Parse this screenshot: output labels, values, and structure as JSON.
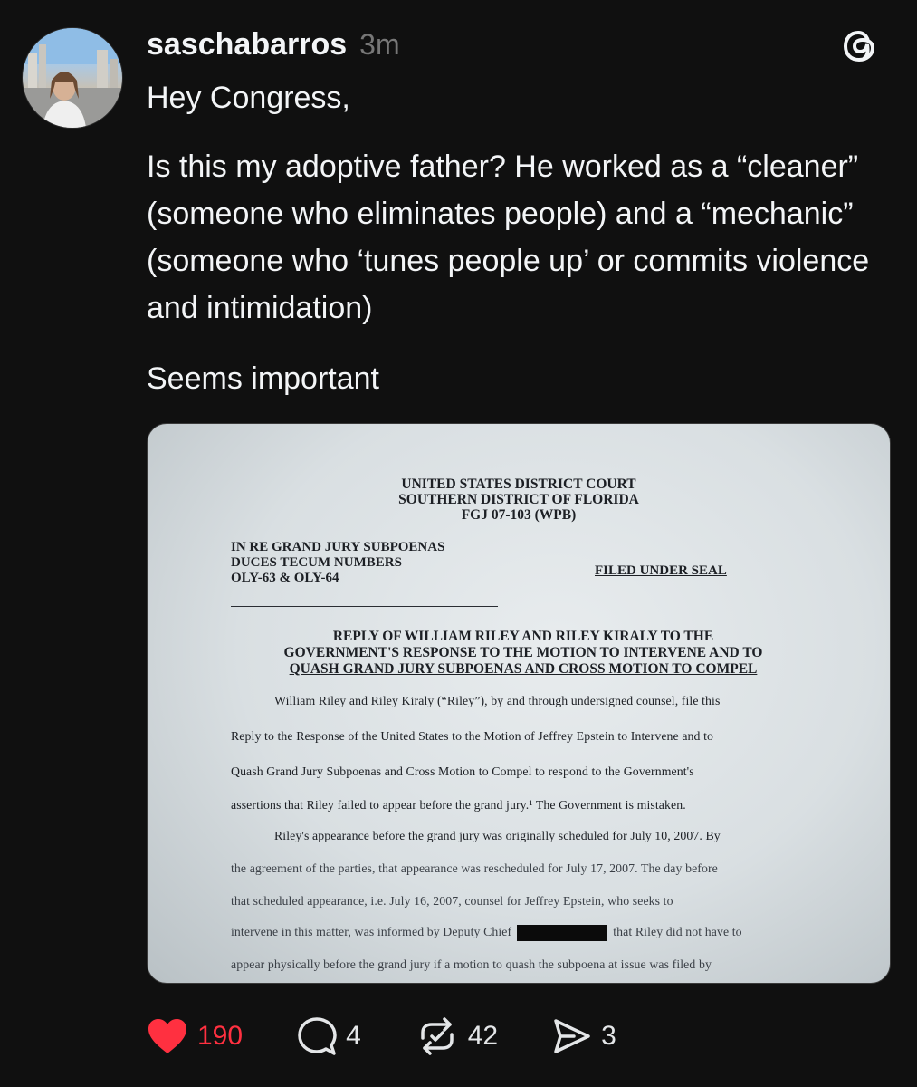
{
  "post": {
    "username": "saschabarros",
    "time": "3m",
    "text_line1": "Hey Congress,",
    "text_para2": "Is this my adoptive father? He worked as a “cleaner” (someone who eliminates people) and a “mechanic” (someone who ‘tunes people up’ or commits violence and intimidation)",
    "text_line3": "Seems important"
  },
  "document": {
    "court_line1": "UNITED STATES DISTRICT COURT",
    "court_line2": "SOUTHERN DISTRICT OF FLORIDA",
    "court_line3": "FGJ 07-103 (WPB)",
    "re_line1": "IN RE GRAND JURY SUBPOENAS",
    "re_line2": "DUCES TECUM NUMBERS",
    "re_line3": "OLY-63 & OLY-64",
    "filed": "FILED UNDER SEAL",
    "title_line1": "REPLY OF WILLIAM RILEY AND RILEY KIRALY TO THE",
    "title_line2": "GOVERNMENT'S RESPONSE TO THE MOTION TO INTERVENE AND TO",
    "title_line3": "QUASH GRAND JURY SUBPOENAS AND CROSS MOTION TO COMPEL",
    "body": [
      "William Riley and Riley Kiraly (“Riley”), by and through undersigned counsel, file this",
      "Reply to the Response of the United States to the Motion of Jeffrey Epstein to Intervene and to",
      "Quash Grand Jury Subpoenas and Cross Motion to Compel to respond to the Government's",
      "assertions that Riley failed to appear before the grand jury.¹ The Government is mistaken.",
      "Riley's appearance before the grand jury was originally scheduled for July 10, 2007. By",
      "the agreement of the parties, that appearance was rescheduled for July 17, 2007. The day before",
      "that scheduled appearance, i.e. July 16, 2007, counsel for Jeffrey Epstein, who seeks to",
      "intervene in this matter, was informed by Deputy Chief",
      "that Riley did not have to",
      "appear physically before the grand jury if a motion to quash the subpoena at issue was filed by"
    ]
  },
  "actions": {
    "likes": "190",
    "replies": "4",
    "reposts": "42",
    "shares": "3"
  },
  "icons": {
    "like": "heart-icon",
    "reply": "comment-icon",
    "repost": "repost-icon",
    "share": "send-icon",
    "app": "threads-icon"
  },
  "colors": {
    "background": "#101010",
    "text": "#f3f5f7",
    "muted": "#777777",
    "like": "#ff3040"
  }
}
